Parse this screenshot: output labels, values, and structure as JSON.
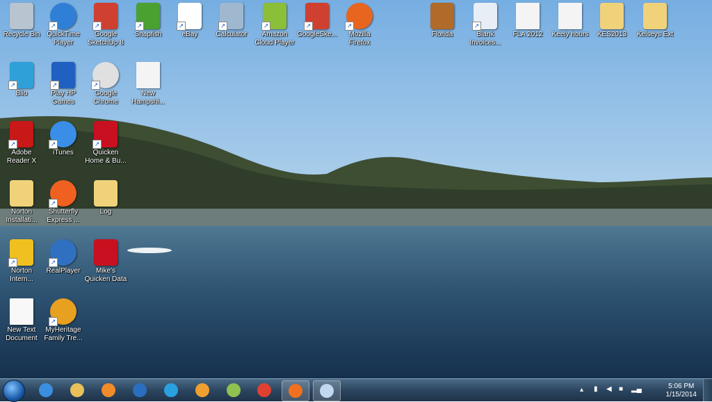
{
  "desktop": {
    "icons": [
      {
        "label": "Recycle Bin",
        "icon": "recycle-bin-icon",
        "x_col": 0,
        "row": 0
      },
      {
        "label": "QuickTime Player",
        "icon": "quicktime-icon"
      },
      {
        "label": "Google SketchUp 8",
        "icon": "sketchup-icon"
      },
      {
        "label": "Snapfish",
        "icon": "snapfish-icon"
      },
      {
        "label": "eBay",
        "icon": "ebay-icon"
      },
      {
        "label": "Calculator",
        "icon": "calculator-icon"
      },
      {
        "label": "Amazon Cloud Player",
        "icon": "amazon-icon"
      },
      {
        "label": "GoogleSke...",
        "icon": "sketchup-icon"
      },
      {
        "label": "Mozilla Firefox",
        "icon": "firefox-icon"
      },
      {
        "label": "Florida",
        "icon": "briefcase-icon"
      },
      {
        "label": "Blank Invoices...",
        "icon": "word-doc-icon"
      },
      {
        "label": "FLA 2012",
        "icon": "document-icon"
      },
      {
        "label": "Keely hours",
        "icon": "document-icon"
      },
      {
        "label": "KES2013",
        "icon": "folder-icon"
      },
      {
        "label": "Kelseys Ext",
        "icon": "folder-icon"
      },
      {
        "label": "Blio",
        "icon": "blio-icon"
      },
      {
        "label": "Play HP Games",
        "icon": "hp-games-icon"
      },
      {
        "label": "Google Chrome",
        "icon": "chrome-icon"
      },
      {
        "label": "New Hampshi...",
        "icon": "document-icon"
      },
      {
        "label": "Adobe Reader X",
        "icon": "adobe-reader-icon"
      },
      {
        "label": "iTunes",
        "icon": "itunes-icon"
      },
      {
        "label": "Quicken Home & Bu...",
        "icon": "quicken-icon"
      },
      {
        "label": "Norton Installati...",
        "icon": "folder-icon"
      },
      {
        "label": "Shutterfly Express ...",
        "icon": "shutterfly-icon"
      },
      {
        "label": "Log",
        "icon": "folder-icon"
      },
      {
        "label": "Norton Intern...",
        "icon": "norton-icon"
      },
      {
        "label": "RealPlayer",
        "icon": "realplayer-icon"
      },
      {
        "label": "Mike's Quicken Data",
        "icon": "quicken-data-icon"
      },
      {
        "label": "New Text Document",
        "icon": "text-document-icon"
      },
      {
        "label": "MyHeritage Family Tre...",
        "icon": "myheritage-icon"
      }
    ]
  },
  "taskbar": {
    "items": [
      {
        "name": "internet-explorer-icon",
        "color": "#3a8fe0"
      },
      {
        "name": "windows-explorer-icon",
        "color": "#e8c15a"
      },
      {
        "name": "media-player-icon",
        "color": "#f08c2a"
      },
      {
        "name": "hp-icon",
        "color": "#2a6fbf"
      },
      {
        "name": "globe-icon",
        "color": "#2aa0e0"
      },
      {
        "name": "photo-gallery-icon",
        "color": "#f0a030"
      },
      {
        "name": "paint-icon",
        "color": "#8fc050"
      },
      {
        "name": "chrome-icon",
        "color": "#e04030"
      },
      {
        "name": "firefox-icon",
        "color": "#f07020"
      },
      {
        "name": "paint-brush-icon",
        "color": "#c0d8f0"
      }
    ],
    "clock_time": "5:06 PM",
    "clock_date": "1/15/2014"
  }
}
